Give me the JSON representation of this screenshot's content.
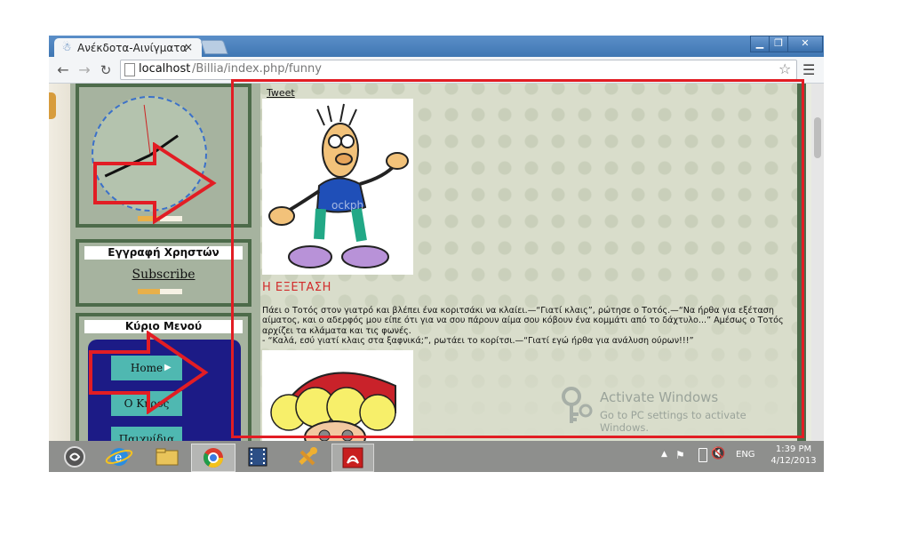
{
  "browser": {
    "tab_title": "Ανέκδοτα-Αινίγματα",
    "tab_close": "×",
    "url_host": "localhost",
    "url_path": "/Billia/index.php/funny",
    "window_buttons": {
      "minimize": "▁",
      "maximize": "❐",
      "close": "✕"
    }
  },
  "sidebar": {
    "registration_title": "Εγγραφή Χρηστών",
    "subscribe_label": "Subscribe",
    "menu_title": "Κύριο Μενού",
    "menu_items": [
      {
        "label": "Home"
      },
      {
        "label": "Ο Κήρος"
      },
      {
        "label": "Παιχνίδια"
      }
    ]
  },
  "content": {
    "tweet_label": "Tweet",
    "joke_title": "Η ΕΞΕΤΑΣΗ",
    "joke_lines": [
      "Πάει ο Τοτός στον γιατρό και βλέπει ένα κοριτσάκι να κλαίει.—“Γιατί κλαις”, ρώτησε ο Τοτός.—“Να ήρθα για εξέταση",
      "αίματος, και ο αδερφός μου είπε ότι για να σου πάρουν αίμα σου κόβουν ένα κομμάτι από το δάχτυλο...” Αμέσως ο Τοτός",
      "αρχίζει τα κλάματα και τις φωνές.",
      "- “Καλά, εσύ γιατί κλαις στα ξαφνικά;”, ρωτάει το κορίτσι.—“Γιατί εγώ ήρθα για ανάλυση ούρων!!!”"
    ],
    "watermark_text": "ockph"
  },
  "activation": {
    "title": "Activate Windows",
    "subtitle": "Go to PC settings to activate Windows."
  },
  "taskbar": {
    "language": "ENG",
    "time": "1:39 PM",
    "date": "4/12/2013"
  },
  "colors": {
    "annotation": "#e21d24",
    "menu_bg": "#1c1b86",
    "menu_item": "#4fb8b1",
    "joke_title": "#d12b2b",
    "panel_border": "#4d6b4a"
  }
}
